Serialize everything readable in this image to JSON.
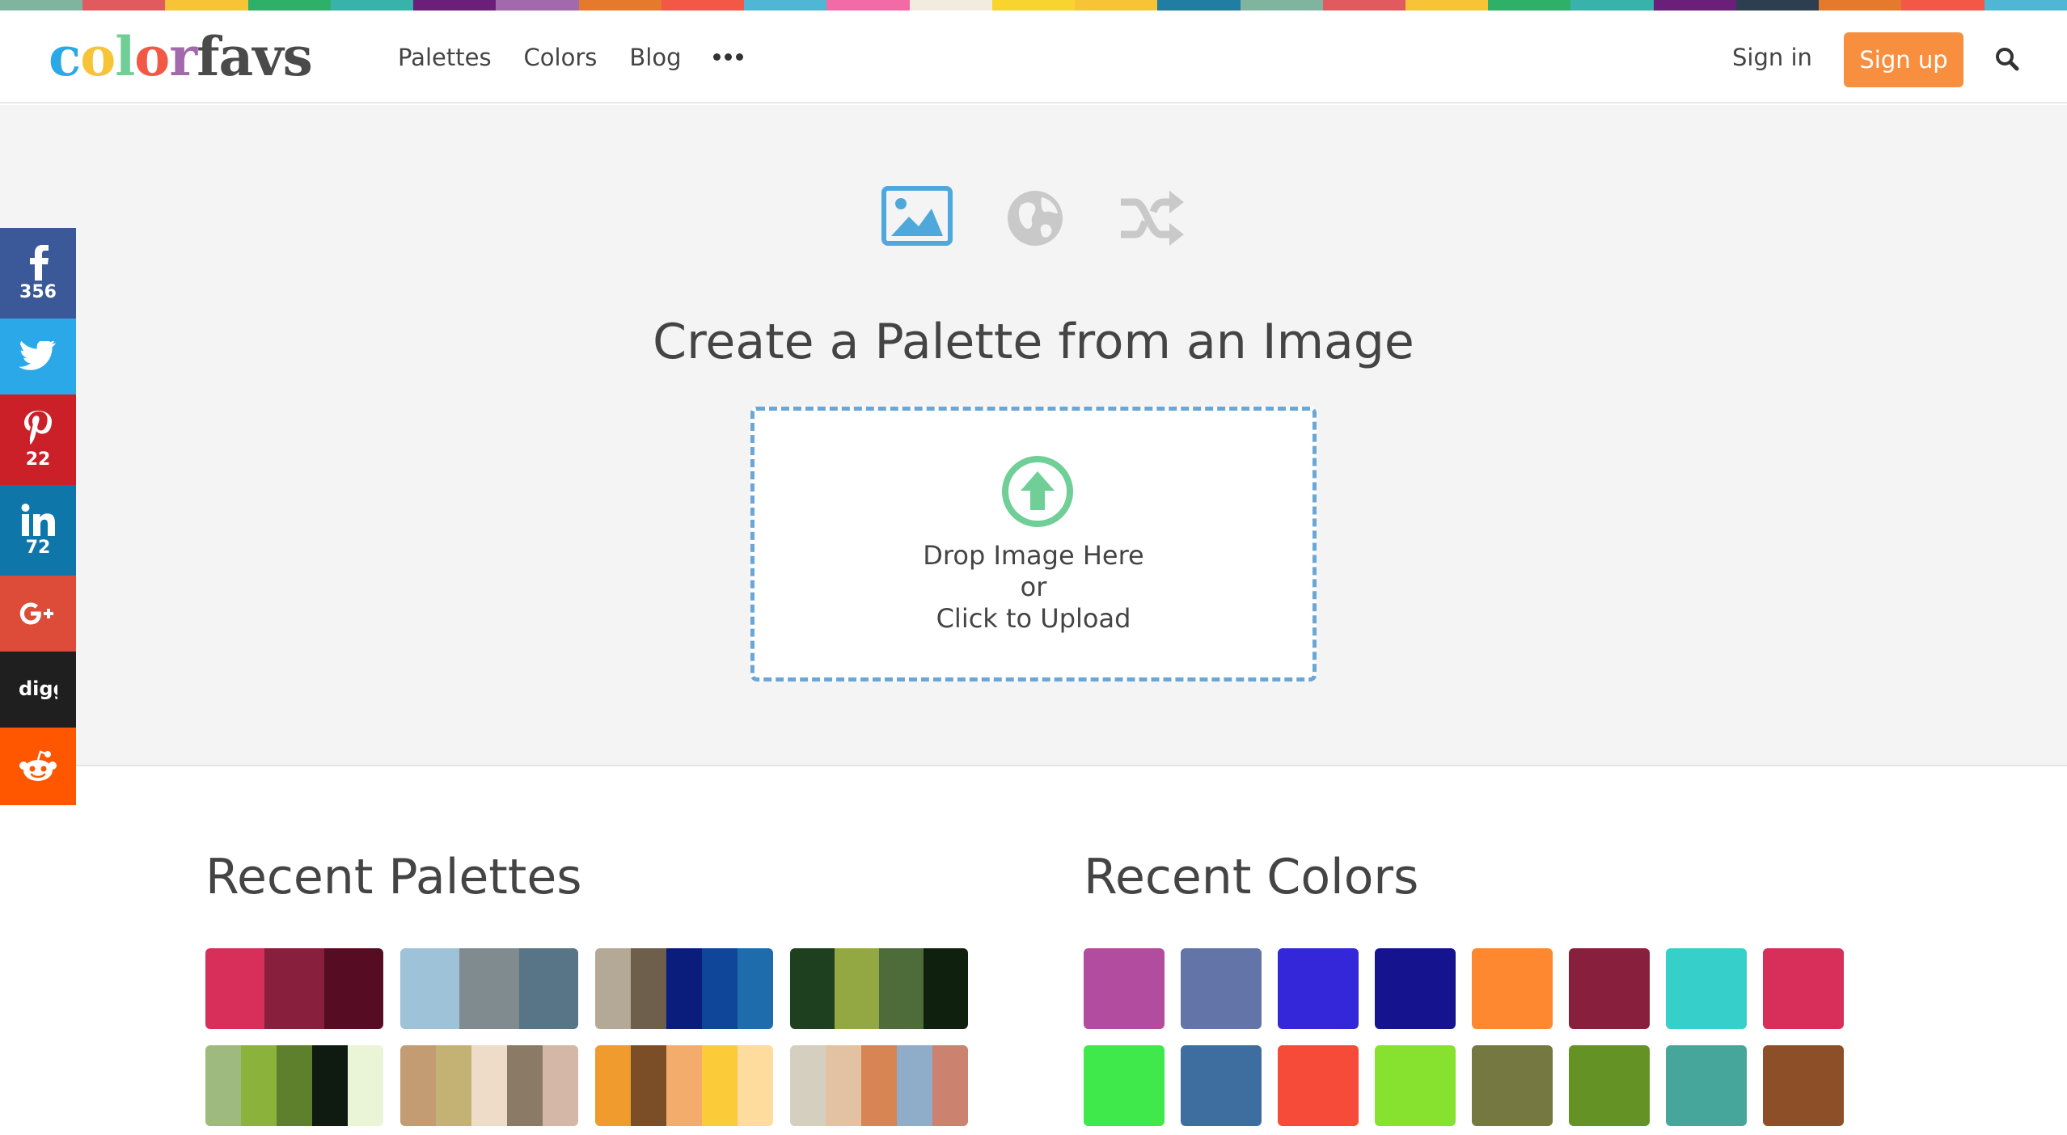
{
  "stripe_colors": [
    "#7fb59e",
    "#e05a5f",
    "#f7c438",
    "#2fb069",
    "#38b3a9",
    "#6a1f7a",
    "#a26aad",
    "#e57a2c",
    "#f25845",
    "#4fb6d3",
    "#f26aa6",
    "#f1ebe0",
    "#f8d52e",
    "#f7c438",
    "#1f7ea1",
    "#7fb59e",
    "#e05a5f",
    "#f7c438",
    "#2fb069",
    "#38b3a9",
    "#6a1f7a",
    "#2c3e50",
    "#e57a2c",
    "#f25845",
    "#4fb6d3"
  ],
  "header": {
    "logo_text": "colorfavs",
    "nav": [
      "Palettes",
      "Colors",
      "Blog"
    ],
    "more_icon": "ellipsis-icon",
    "signin": "Sign in",
    "signup": "Sign up",
    "search_icon": "search-icon",
    "signup_color": "#f78f3f"
  },
  "hero": {
    "modes": [
      {
        "icon": "image-icon",
        "active": true
      },
      {
        "icon": "globe-icon",
        "active": false
      },
      {
        "icon": "shuffle-icon",
        "active": false
      }
    ],
    "title": "Create a Palette from an Image",
    "dropzone": {
      "icon": "upload-arrow-icon",
      "line1": "Drop Image Here",
      "line2": "or",
      "line3": "Click to Upload"
    }
  },
  "social": [
    {
      "network": "facebook",
      "icon": "facebook-icon",
      "count": "356",
      "color": "#3b5998"
    },
    {
      "network": "twitter",
      "icon": "twitter-icon",
      "count": "",
      "color": "#2aa8e8"
    },
    {
      "network": "pinterest",
      "icon": "pinterest-icon",
      "count": "22",
      "color": "#cb2027"
    },
    {
      "network": "linkedin",
      "icon": "linkedin-icon",
      "count": "72",
      "color": "#0e76a8"
    },
    {
      "network": "googleplus",
      "icon": "google-plus-icon",
      "count": "",
      "color": "#dd4b39"
    },
    {
      "network": "digg",
      "icon": "digg-icon",
      "count": "",
      "color": "#1f1f1f"
    },
    {
      "network": "reddit",
      "icon": "reddit-icon",
      "count": "",
      "color": "#ff5700"
    }
  ],
  "recent_palettes": {
    "title": "Recent Palettes",
    "palettes": [
      [
        "#d72f5a",
        "#881f3c",
        "#560c22"
      ],
      [
        "#9ec3d8",
        "#808b90",
        "#587487"
      ],
      [
        "#b4a996",
        "#6e5f4c",
        "#0a1d7c",
        "#0f4699",
        "#1f6cad"
      ],
      [
        "#1f401f",
        "#93a842",
        "#4e6b3a",
        "#10200f"
      ],
      [
        "#9fba7e",
        "#8bb33c",
        "#5e7f2c",
        "#0f1b10",
        "#eaf5d8"
      ],
      [
        "#c49c74",
        "#c4b275",
        "#eedcc8",
        "#8a7a66",
        "#d4b7a7"
      ],
      [
        "#ef9b2e",
        "#7b4e28",
        "#f4ac6d",
        "#fccb3a",
        "#fddc9d"
      ],
      [
        "#d4cfbf",
        "#e3c2a3",
        "#d78553",
        "#8facc8",
        "#cb8370"
      ]
    ]
  },
  "recent_colors": {
    "title": "Recent Colors",
    "colors": [
      "#b24c9f",
      "#6274a8",
      "#3427d9",
      "#16138f",
      "#fd8830",
      "#881f3c",
      "#36cfc9",
      "#d72f5a",
      "#3fe94b",
      "#3e6e9f",
      "#f74b39",
      "#86e22e",
      "#767842",
      "#659225",
      "#46a69c",
      "#8c4f27"
    ]
  }
}
